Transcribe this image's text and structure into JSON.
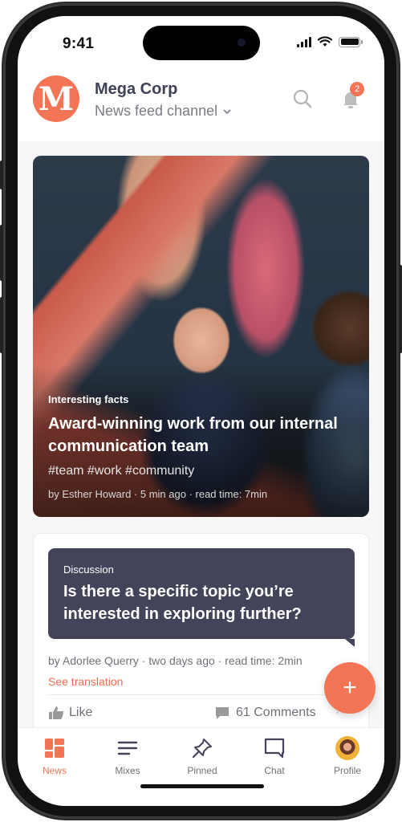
{
  "status_bar": {
    "time": "9:41"
  },
  "header": {
    "logo_letter": "M",
    "org_name": "Mega Corp",
    "channel": "News feed channel",
    "channel_chevron": "⌄",
    "notification_count": "2",
    "icons": {
      "search": "search-icon",
      "notifications": "bell-icon",
      "chevron": "chevron-down-icon"
    }
  },
  "feed": {
    "hero": {
      "category": "Interesting facts",
      "title": "Award-winning work from our internal communication team",
      "tags": "#team #work #community",
      "meta": "by Esther Howard · 5 min ago · read time: 7min"
    },
    "discussion": {
      "category": "Discussion",
      "title": "Is there a specific topic you’re interested in exploring further?",
      "meta": "by Adorlee Querry · two days ago · read time: 2min",
      "translation_link": "See translation",
      "like_label": "Like",
      "comments_label": "61 Comments",
      "more_label": "···"
    }
  },
  "fab": {
    "label": "+"
  },
  "tab_bar": {
    "items": [
      {
        "label": "News",
        "icon": "grid-icon",
        "active": true
      },
      {
        "label": "Mixes",
        "icon": "lines-icon",
        "active": false
      },
      {
        "label": "Pinned",
        "icon": "pin-icon",
        "active": false
      },
      {
        "label": "Chat",
        "icon": "chat-bubble-icon",
        "active": false
      },
      {
        "label": "Profile",
        "icon": "avatar",
        "active": false
      }
    ]
  },
  "colors": {
    "accent": "#f47555",
    "dark_bubble": "#43435a",
    "text_primary": "#3f4157",
    "text_secondary": "#6f7079"
  }
}
